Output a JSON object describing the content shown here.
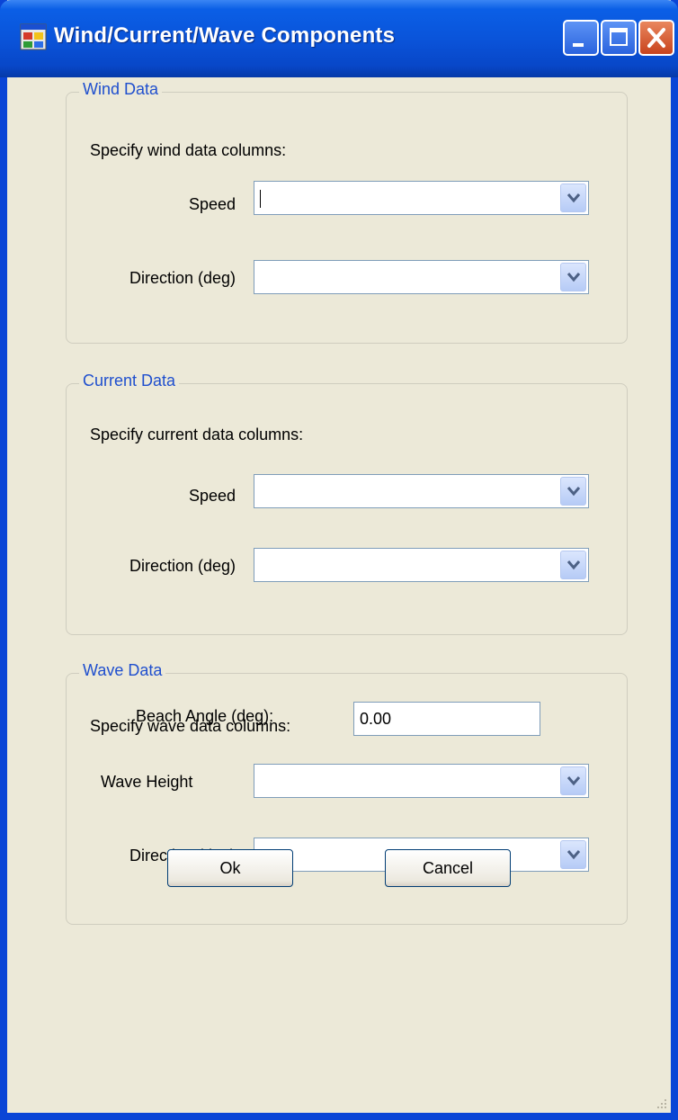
{
  "window": {
    "title": "Wind/Current/Wave Components",
    "icon": "application-window-icon",
    "controls": [
      "minimize-icon",
      "maximize-icon",
      "close-icon"
    ]
  },
  "wind": {
    "legend": "Wind Data",
    "description": "Specify wind data columns:",
    "speed_label": "Speed",
    "speed_value": "",
    "direction_label": "Direction (deg)",
    "direction_value": ""
  },
  "current": {
    "legend": "Current Data",
    "description": "Specify current data columns:",
    "speed_label": "Speed",
    "speed_value": "",
    "direction_label": "Direction (deg)",
    "direction_value": ""
  },
  "wave": {
    "legend": "Wave Data",
    "description": "Specify wave data columns:",
    "height_label": "Wave Height",
    "height_value": "",
    "direction_label": "Direction (deg)",
    "direction_value": ""
  },
  "beach": {
    "label": "Beach Angle (deg):",
    "value": "0.00"
  },
  "buttons": {
    "ok": "Ok",
    "cancel": "Cancel"
  },
  "colors": {
    "title_bar": "#0a54da",
    "group_legend": "#1f4fce",
    "dialog_bg": "#ece9d8"
  }
}
